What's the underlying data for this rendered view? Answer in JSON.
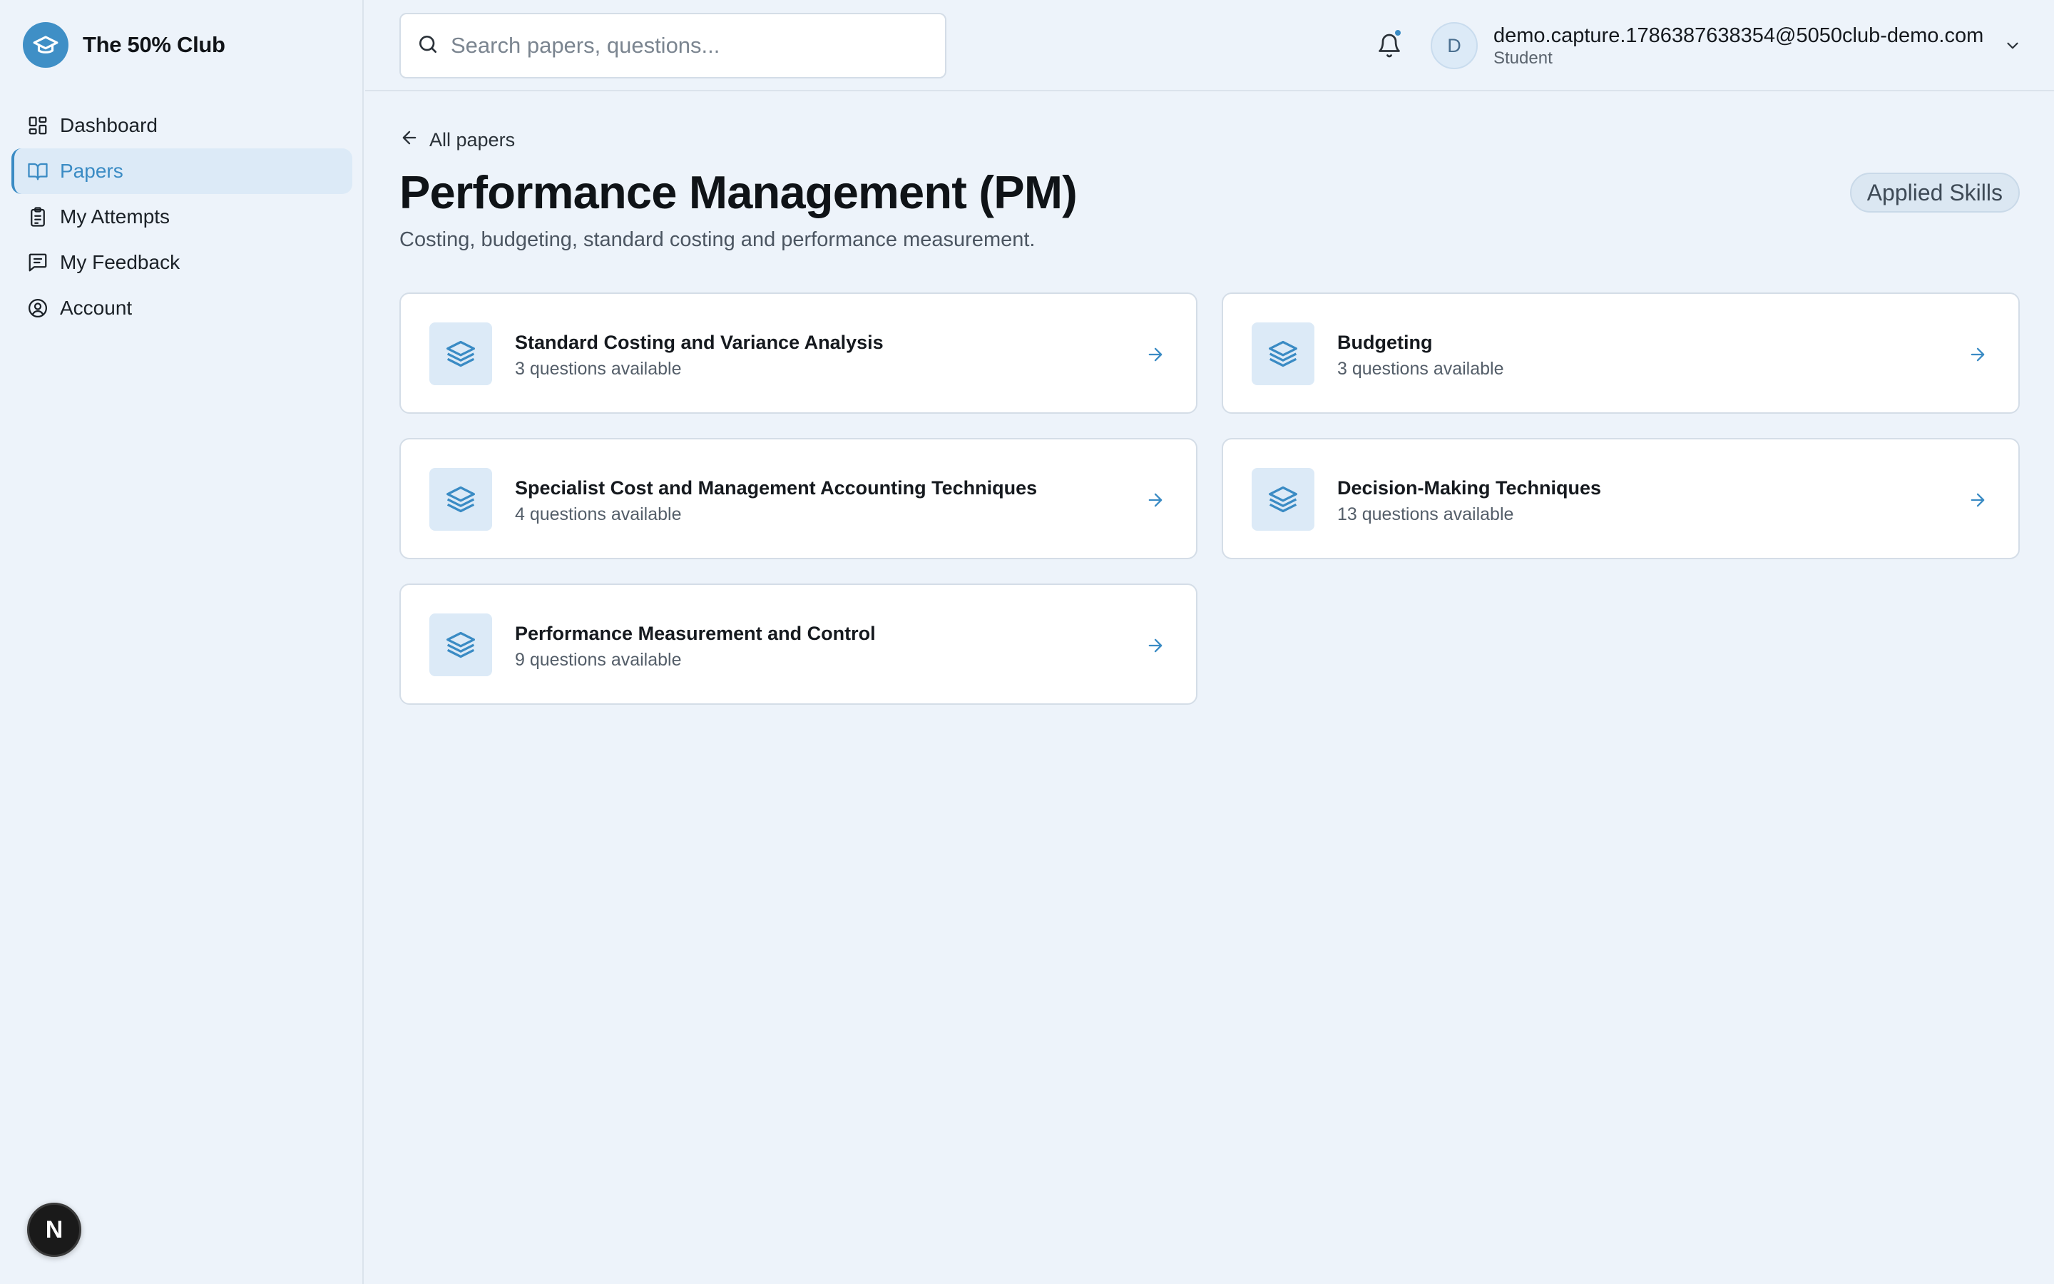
{
  "brand": {
    "name": "The 50% Club"
  },
  "sidebar": {
    "items": [
      {
        "label": "Dashboard",
        "icon": "dashboard-icon",
        "active": false
      },
      {
        "label": "Papers",
        "icon": "book-icon",
        "active": true
      },
      {
        "label": "My Attempts",
        "icon": "clipboard-icon",
        "active": false
      },
      {
        "label": "My Feedback",
        "icon": "message-icon",
        "active": false
      },
      {
        "label": "Account",
        "icon": "user-circle-icon",
        "active": false
      }
    ],
    "dev_badge": "N"
  },
  "header": {
    "search_placeholder": "Search papers, questions...",
    "user": {
      "initial": "D",
      "email": "demo.capture.1786387638354@5050club-demo.com",
      "role": "Student"
    }
  },
  "main": {
    "back_label": "All papers",
    "title": "Performance Management (PM)",
    "tag": "Applied Skills",
    "subtitle": "Costing, budgeting, standard costing and performance measurement.",
    "topics": [
      {
        "title": "Standard Costing and Variance Analysis",
        "count": "3 questions available"
      },
      {
        "title": "Budgeting",
        "count": "3 questions available"
      },
      {
        "title": "Specialist Cost and Management Accounting Techniques",
        "count": "4 questions available"
      },
      {
        "title": "Decision-Making Techniques",
        "count": "13 questions available"
      },
      {
        "title": "Performance Measurement and Control",
        "count": "9 questions available"
      }
    ]
  },
  "colors": {
    "accent": "#3a8bc4",
    "background": "#edf3fa",
    "card": "#ffffff",
    "icon_tile": "#dceaf7"
  }
}
